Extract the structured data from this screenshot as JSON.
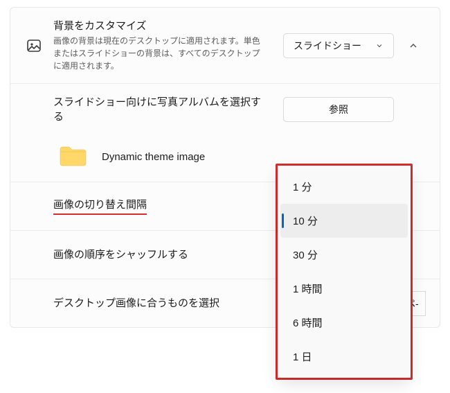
{
  "customize": {
    "title": "背景をカスタマイズ",
    "desc": "画像の背景は現在のデスクトップに適用されます。単色またはスライドショーの背景は、すべてのデスクトップに適用されます。",
    "selected": "スライドショー"
  },
  "album": {
    "title": "スライドショー向けに写真アルバムを選択する",
    "browse": "参照",
    "folder": "Dynamic theme image"
  },
  "interval": {
    "title": "画像の切り替え間隔",
    "options": [
      "1 分",
      "10 分",
      "30 分",
      "1 時間",
      "6 時間",
      "1 日"
    ],
    "selected_index": 1
  },
  "shuffle": {
    "title": "画像の順序をシャッフルする"
  },
  "fit": {
    "title": "デスクトップ画像に合うものを選択",
    "truncated": "ペ-"
  }
}
